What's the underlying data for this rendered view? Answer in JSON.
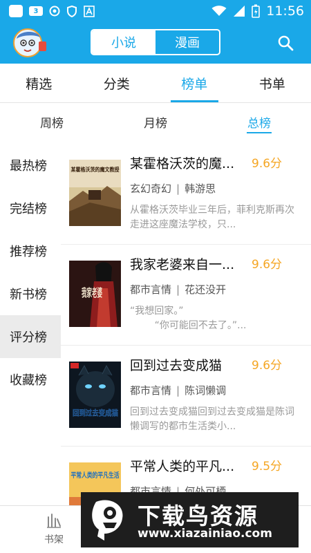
{
  "status_bar": {
    "time": "11:56",
    "icons": [
      "app-icon",
      "data-3g-icon",
      "vpn-icon",
      "shield-icon",
      "text-a-icon",
      "wifi-icon",
      "signal-icon",
      "battery-icon"
    ],
    "tag_text": "3"
  },
  "header": {
    "segments": [
      "小说",
      "漫画"
    ],
    "active_segment": "小说",
    "accent": "#1aa8e8"
  },
  "tabs": [
    "精选",
    "分类",
    "榜单",
    "书单"
  ],
  "active_tab": "榜单",
  "sub_tabs": [
    "周榜",
    "月榜",
    "总榜"
  ],
  "active_sub_tab": "总榜",
  "side_nav": [
    "最热榜",
    "完结榜",
    "推荐榜",
    "新书榜",
    "评分榜",
    "收藏榜"
  ],
  "active_side": "评分榜",
  "books": [
    {
      "title": "某霍格沃茨的魔...",
      "score": "9.6分",
      "genre": "玄幻奇幻",
      "author": "韩游思",
      "desc": "从霍格沃茨毕业三年后，菲利克斯再次走进这座魔法学校，只...",
      "cover_text": "某霍格沃茨的魔文教授"
    },
    {
      "title": "我家老婆来自一...",
      "score": "9.6分",
      "genre": "都市言情",
      "author": "花还没开",
      "desc": "“我想回家。”\n        “你可能回不去了。”...",
      "cover_text": "我家老婆"
    },
    {
      "title": "回到过去变成猫",
      "score": "9.6分",
      "genre": "都市言情",
      "author": "陈词懒调",
      "desc": "回到过去变成猫回到过去变成猫是陈词懒调写的都市生活类小...",
      "cover_text": "回到过去变成猫"
    },
    {
      "title": "平常人类的平凡...",
      "score": "9.5分",
      "genre": "都市言情",
      "author": "何处可栖",
      "desc": "",
      "cover_text": "平常人类的平凡生活"
    }
  ],
  "bottom_nav": {
    "bookshelf_label": "书架"
  },
  "watermark": {
    "text": "下载鸟资源",
    "url": "www.xiazainiao.com"
  },
  "colors": {
    "accent": "#1aa8e8",
    "score": "#f5a623"
  }
}
